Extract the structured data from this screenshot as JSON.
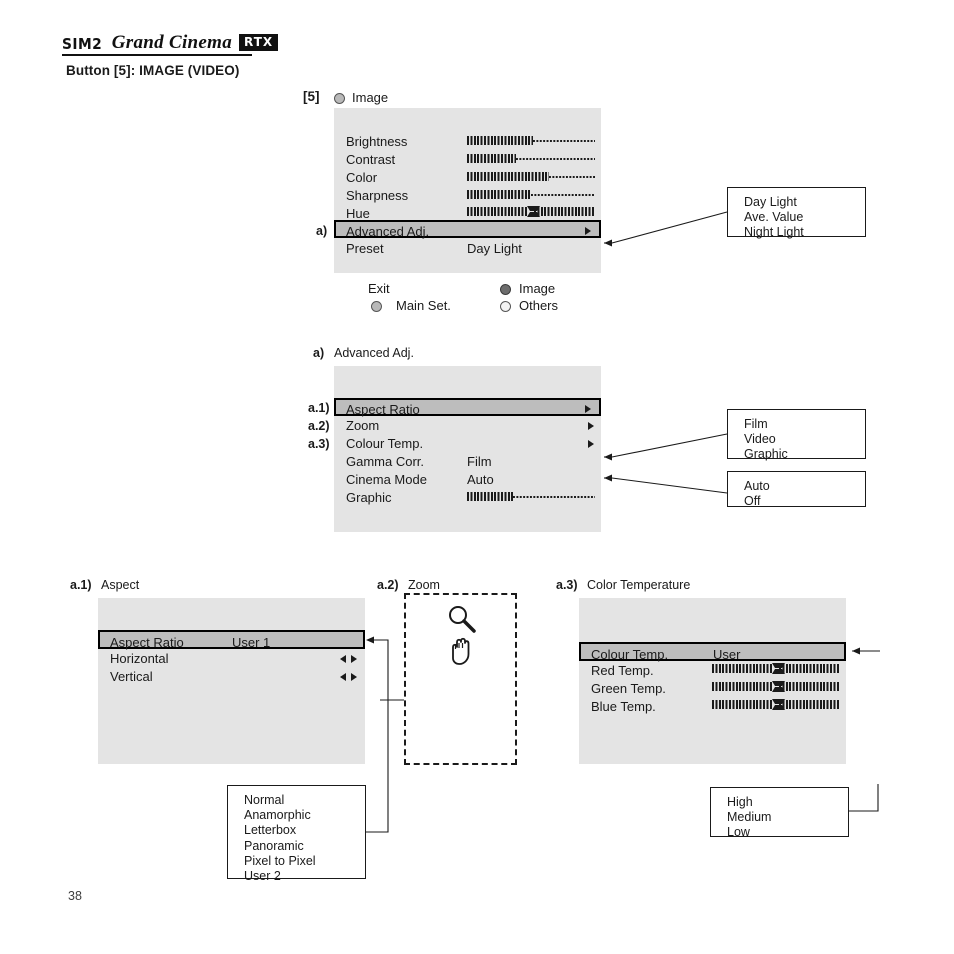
{
  "brand": {
    "sim2": "SIM2",
    "grand_cinema": "Grand Cinema",
    "model": "RTX"
  },
  "page_title": "Button [5]: IMAGE (VIDEO)",
  "page_number": "38",
  "image_menu": {
    "step_tag": "[5]",
    "title": "Image",
    "title_icon": "radio-dot-icon",
    "rows": [
      {
        "label": "Brightness",
        "type": "bar",
        "fill_pct": 52
      },
      {
        "label": "Contrast",
        "type": "bar",
        "fill_pct": 38
      },
      {
        "label": "Color",
        "type": "bar",
        "fill_pct": 64
      },
      {
        "label": "Sharpness",
        "type": "bar",
        "fill_pct": 50
      },
      {
        "label": "Hue",
        "type": "center-bar",
        "fill_pct": 50
      },
      {
        "label": "Advanced Adj.",
        "type": "submenu",
        "tag": "a)",
        "highlighted": true
      },
      {
        "label": "Preset",
        "type": "value",
        "value": "Day Light"
      }
    ],
    "footer": {
      "exit": "Exit",
      "main_set": "Main Set.",
      "image": "Image",
      "others": "Others"
    },
    "preset_options": [
      "Day Light",
      "Ave. Value",
      "Night Light"
    ]
  },
  "advanced_menu": {
    "tag": "a)",
    "title": "Advanced Adj.",
    "rows": [
      {
        "tag": "a.1)",
        "label": "Aspect Ratio",
        "type": "submenu",
        "highlighted": true
      },
      {
        "tag": "a.2)",
        "label": "Zoom",
        "type": "submenu"
      },
      {
        "tag": "a.3)",
        "label": "Colour Temp.",
        "type": "submenu"
      },
      {
        "tag": "",
        "label": "Gamma Corr.",
        "type": "value",
        "value": "Film"
      },
      {
        "tag": "",
        "label": "Cinema Mode",
        "type": "value",
        "value": "Auto"
      },
      {
        "tag": "",
        "label": "Graphic",
        "type": "bar",
        "fill_pct": 36
      }
    ],
    "gamma_options": [
      "Film",
      "Video",
      "Graphic"
    ],
    "cinema_options": [
      "Auto",
      "Off"
    ]
  },
  "aspect_panel": {
    "tag": "a.1)",
    "title": "Aspect",
    "rows": [
      {
        "label": "Aspect Ratio",
        "value": "User 1",
        "highlighted": true
      },
      {
        "label": "Horizontal",
        "type": "arrows"
      },
      {
        "label": "Vertical",
        "type": "arrows"
      }
    ],
    "options": [
      "Normal",
      "Anamorphic",
      "Letterbox",
      "Panoramic",
      "Pixel to Pixel",
      "User 2"
    ]
  },
  "zoom_panel": {
    "tag": "a.2)",
    "title": "Zoom",
    "icons": [
      "magnifier-icon",
      "hand-icon"
    ]
  },
  "color_temp_panel": {
    "tag": "a.3)",
    "title": "Color Temperature",
    "rows": [
      {
        "label": "Colour Temp.",
        "value": "User",
        "highlighted": true
      },
      {
        "label": "Red Temp.",
        "type": "center-bar",
        "fill_pct": 50
      },
      {
        "label": "Green Temp.",
        "type": "center-bar",
        "fill_pct": 50
      },
      {
        "label": "Blue Temp.",
        "type": "center-bar",
        "fill_pct": 50
      }
    ],
    "options": [
      "High",
      "Medium",
      "Low"
    ]
  },
  "colors": {
    "panel_bg": "#e4e4e4",
    "highlight_bg": "#bdbdbd",
    "ink": "#1a1a1a"
  }
}
